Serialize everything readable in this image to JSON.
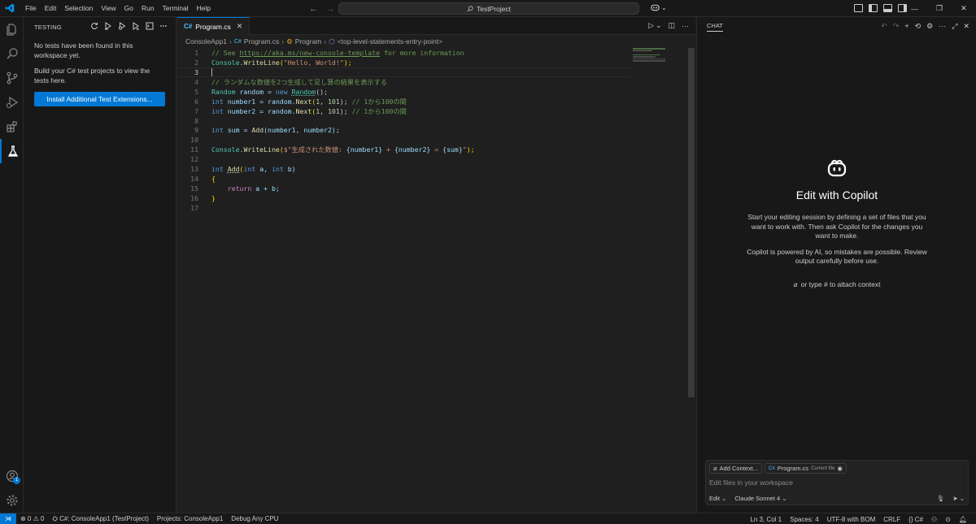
{
  "menu": [
    "File",
    "Edit",
    "Selection",
    "View",
    "Go",
    "Run",
    "Terminal",
    "Help"
  ],
  "command_center": {
    "label": "TestProject"
  },
  "sidebar": {
    "title": "TESTING",
    "no_tests": "No tests have been found in this workspace yet.",
    "build_hint": "Build your C# test projects to view the tests here.",
    "install_button": "Install Additional Test Extensions..."
  },
  "editor": {
    "tab": {
      "icon_text": "C#",
      "label": "Program.cs"
    },
    "breadcrumbs": [
      "ConsoleApp1",
      "Program.cs",
      "Program",
      "<top-level-statements-entry-point>"
    ],
    "line_numbers": [
      "1",
      "2",
      "3",
      "4",
      "5",
      "6",
      "7",
      "8",
      "9",
      "10",
      "11",
      "12",
      "13",
      "14",
      "15",
      "16",
      "17"
    ],
    "current_line": 3,
    "code": {
      "l1a": "// See ",
      "l1b": "https://aka.ms/new-console-template",
      "l1c": " for more information",
      "l2a": "Console",
      "l2b": ".",
      "l2c": "WriteLine",
      "l2d": "(",
      "l2e": "\"Hello, World!\"",
      "l2f": ");",
      "l4": "// ランダムな数値を2つ生成して足し算の結果を表示する",
      "l5a": "Random",
      "l5b": " random = ",
      "l5c": "new",
      "l5d": " ",
      "l5e": "Random",
      "l5f": "();",
      "l6a": "int",
      "l6b": " number1 = random.",
      "l6c": "Next",
      "l6d": "(",
      "l6e": "1",
      "l6f": ", ",
      "l6g": "101",
      "l6h": "); ",
      "l6i": "// 1から100の間",
      "l7a": "int",
      "l7b": " number2 = random.",
      "l7c": "Next",
      "l7d": "(",
      "l7e": "1",
      "l7f": ", ",
      "l7g": "101",
      "l7h": "); ",
      "l7i": "// 1から100の間",
      "l9a": "int",
      "l9b": " sum = ",
      "l9c": "Add",
      "l9d": "(number1, number2);",
      "l11a": "Console",
      "l11b": ".",
      "l11c": "WriteLine",
      "l11d": "(",
      "l11e": "$\"生成された数値: ",
      "l11f": "{number1}",
      "l11g": " + ",
      "l11h": "{number2}",
      "l11i": " = ",
      "l11j": "{sum}",
      "l11k": "\"",
      "l11l": ");",
      "l13a": "int",
      "l13b": " ",
      "l13c": "Add",
      "l13d": "(",
      "l13e": "int",
      "l13f": " a, ",
      "l13g": "int",
      "l13h": " b)",
      "l14": "{",
      "l15a": "    ",
      "l15b": "return",
      "l15c": " a + b;",
      "l16": "}"
    }
  },
  "chat": {
    "tab_label": "CHAT",
    "title": "Edit with Copilot",
    "description": "Start your editing session by defining a set of files that you want to work with. Then ask Copilot for the changes you want to make.",
    "disclaimer": "Copilot is powered by AI, so mistakes are possible. Review output carefully before use.",
    "attach_hint": "or type # to attach context",
    "add_context": "Add Context...",
    "file_chip": "Program.cs",
    "file_chip_note": "Current file",
    "placeholder": "Edit files in your workspace",
    "mode": "Edit",
    "model": "Claude Sonnet 4"
  },
  "status": {
    "problems": "⊗ 0 ⚠ 0",
    "project": "C#: ConsoleApp1 (TestProject)",
    "projects": "Projects: ConsoleApp1",
    "debug": "Debug Any CPU",
    "position": "Ln 3, Col 1",
    "spaces": "Spaces: 4",
    "encoding": "UTF-8 with BOM",
    "eol": "CRLF",
    "language": "C#"
  },
  "colors": {
    "accent": "#0078d4",
    "editor_bg": "#1f1f1f",
    "sidebar_bg": "#181818"
  }
}
